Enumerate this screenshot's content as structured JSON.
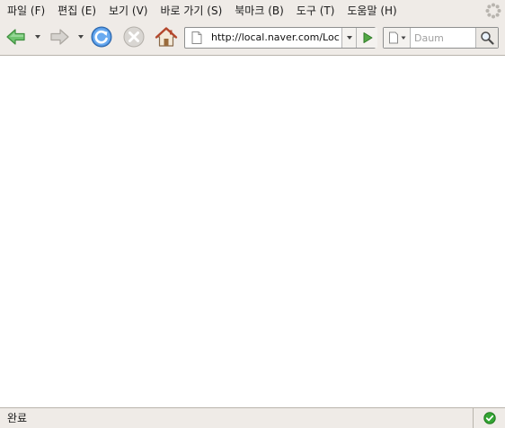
{
  "menubar": {
    "items": [
      {
        "label": "파일 (F)"
      },
      {
        "label": "편집 (E)"
      },
      {
        "label": "보기 (V)"
      },
      {
        "label": "바로 가기 (S)"
      },
      {
        "label": "북마크 (B)"
      },
      {
        "label": "도구 (T)"
      },
      {
        "label": "도움말 (H)"
      }
    ]
  },
  "toolbar": {
    "back_icon": "back-arrow-icon",
    "forward_icon": "forward-arrow-icon",
    "reload_icon": "reload-icon",
    "stop_icon": "stop-icon",
    "home_icon": "home-icon"
  },
  "urlbar": {
    "value": "http://local.naver.com/Loc"
  },
  "search": {
    "placeholder": "Daum"
  },
  "status": {
    "text": "완료"
  },
  "colors": {
    "chrome_bg": "#efebe7",
    "content_bg": "#ffffff",
    "back_green": "#5cb85c",
    "reload_blue": "#3a78c9",
    "go_green": "#4a9a3a",
    "secure_green": "#2e9b2e"
  }
}
